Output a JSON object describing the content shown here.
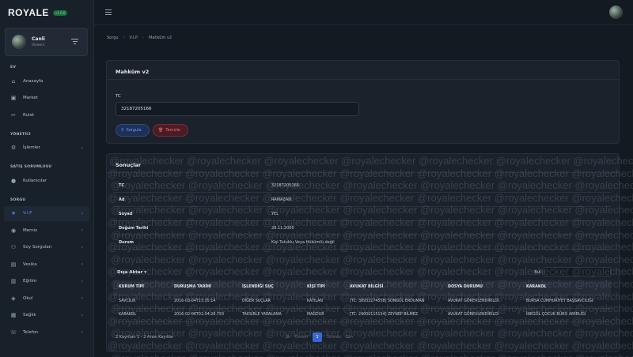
{
  "brand": {
    "name": "ROYALE",
    "badge": "v1.0.0"
  },
  "user": {
    "name": "Canli",
    "role": "Vizeerz"
  },
  "sidebar": {
    "sections": [
      {
        "title": "EV",
        "items": [
          {
            "label": "Anasayfa",
            "icon": "home-icon",
            "glyph": "⌂",
            "chevron": false,
            "active": false
          },
          {
            "label": "Market",
            "icon": "market-icon",
            "glyph": "▣",
            "chevron": false,
            "active": false
          },
          {
            "label": "Rulet",
            "icon": "roulette-icon",
            "glyph": "✂",
            "chevron": false,
            "active": false
          }
        ]
      },
      {
        "title": "YÖNETİCİ",
        "items": [
          {
            "label": "İşlemler",
            "icon": "operations-icon",
            "glyph": "⚙",
            "chevron": true,
            "active": false
          }
        ]
      },
      {
        "title": "SATIŞ SORUMLUSU",
        "items": [
          {
            "label": "Kullanıcılar",
            "icon": "users-icon",
            "glyph": "●",
            "chevron": false,
            "active": false
          }
        ]
      },
      {
        "title": "SORGU",
        "items": [
          {
            "label": "V.I.P",
            "icon": "star-icon",
            "glyph": "★",
            "chevron": true,
            "active": true
          },
          {
            "label": "Mernis",
            "icon": "mernis-icon",
            "glyph": "◉",
            "chevron": true,
            "active": false
          },
          {
            "label": "Soy Sorguları",
            "icon": "family-tree-icon",
            "glyph": "⚇",
            "chevron": true,
            "active": false
          },
          {
            "label": "Vesika",
            "icon": "id-card-icon",
            "glyph": "▤",
            "chevron": true,
            "active": false
          },
          {
            "label": "Eğitim",
            "icon": "education-icon",
            "glyph": "▥",
            "chevron": true,
            "active": false
          },
          {
            "label": "Okul",
            "icon": "school-icon",
            "glyph": "◈",
            "chevron": true,
            "active": false
          },
          {
            "label": "Sağlık",
            "icon": "health-icon",
            "glyph": "▦",
            "chevron": true,
            "active": false
          },
          {
            "label": "Telefon",
            "icon": "phone-icon",
            "glyph": "☏",
            "chevron": true,
            "active": false
          }
        ]
      }
    ]
  },
  "breadcrumb": [
    "Sorgu",
    "V.I.P",
    "Mahkûm v2"
  ],
  "query_panel": {
    "title": "Mahkûm v2",
    "tc_label": "TC",
    "tc_value": "32187205166",
    "query_button": "Sorgula",
    "clear_button": "Temizle"
  },
  "results": {
    "title": "Sonuçlar",
    "fields": [
      {
        "key": "TC",
        "value": "32187205166"
      },
      {
        "key": "Ad",
        "value": "RAMAZAN"
      },
      {
        "key": "Soyad",
        "value": "YEL"
      },
      {
        "key": "Doğum Tarihi",
        "value": "28.11.2000"
      },
      {
        "key": "Durum",
        "value": "Kişi Tutuklu Veya Hükümlü değil"
      }
    ],
    "export_label": "Dışa Aktar",
    "search_label": "Bul:",
    "columns": [
      "KURUM TİPİ",
      "DURUŞMA TARİHİ",
      "İŞLENDİĞİ SUÇ",
      "KİŞİ TİPİ",
      "AVUKAT BİLGİSİ",
      "DOSYA DURUMU",
      "KARAKOL"
    ],
    "rows": [
      [
        "SAVCILIK",
        "2016-03-04T13:35:14",
        "DİĞER SUÇLAR",
        "KATILAN",
        "[TC: 38932274558] SONGÜL ERDUMAN",
        "AVUKAT GÖREVLENDİRİLDİ",
        "BURSA CUMHURİYET BAŞSAVCILIĞI"
      ],
      [
        "KARAKOL",
        "2016-02-06T01:04:28.793",
        "TAKSİRLE YARALAMA",
        "MAĞDUR",
        "[TC: 29000115154] ZEYNEP BİLMEZ",
        "AVUKAT GÖREVLENDİRİLDİ",
        "İNEGÖL ÇOCUK BÜRO AMİRLİĞİ"
      ]
    ],
    "showing": "2 Kayıttan 1 - 2 Arası Kayıtlar",
    "pager": {
      "first": "İlk",
      "prev": "Önceki",
      "current": "1",
      "next": "Sonraki",
      "last": "Son"
    }
  },
  "watermark_text": "@royalechecker",
  "colors": {
    "accent": "#3566d6",
    "danger": "#f06a7a",
    "background": "#141a22"
  }
}
